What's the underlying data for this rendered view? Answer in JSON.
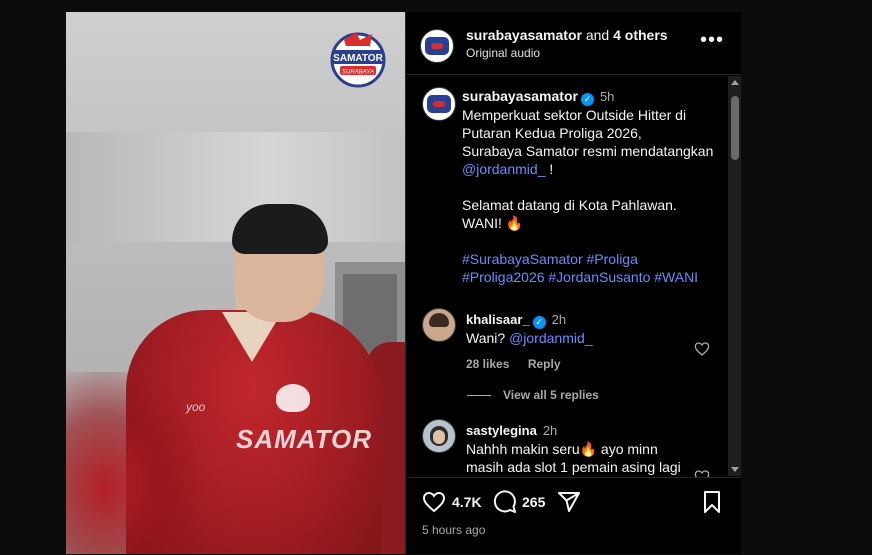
{
  "media": {
    "logo_text_top": "SAMATOR",
    "logo_text_bottom": "SURABAYA",
    "jersey_text": "SAMATOR",
    "jersey_brand": "yoo"
  },
  "header": {
    "username": "surabayasamator",
    "and_text": " and ",
    "others": "4 others",
    "audio": "Original audio",
    "more_label": "•••"
  },
  "post": {
    "username": "surabayasamator",
    "verified_mark": "✓",
    "time": "5h",
    "caption_line1": "Memperkuat sektor Outside Hitter di Putaran Kedua Proliga 2026,",
    "caption_line2": "Surabaya Samator resmi mendatangkan",
    "mention": "@jordanmid_",
    "caption_line2_end": " !",
    "caption_line3": "Selamat datang di Kota Pahlawan.",
    "caption_line4": "WANI! 🔥",
    "hashtags_line1": "#SurabayaSamator #Proliga",
    "hashtags_line2": "#Proliga2026 #JordanSusanto #WANI"
  },
  "comments": [
    {
      "username": "khalisaar_",
      "verified_mark": "✓",
      "time": "2h",
      "text_prefix": "Wani? ",
      "mention": "@jordanmid_",
      "likes": "28 likes",
      "reply": "Reply",
      "view_replies": "View all 5 replies"
    },
    {
      "username": "sastylegina",
      "time": "2h",
      "line1": "Nahhh makin seru🔥 ayo minn",
      "line2": "masih ada slot 1 pemain asing lagi"
    }
  ],
  "actions": {
    "likes_count": "4.7K",
    "comments_count": "265",
    "timestamp": "5 hours ago"
  }
}
